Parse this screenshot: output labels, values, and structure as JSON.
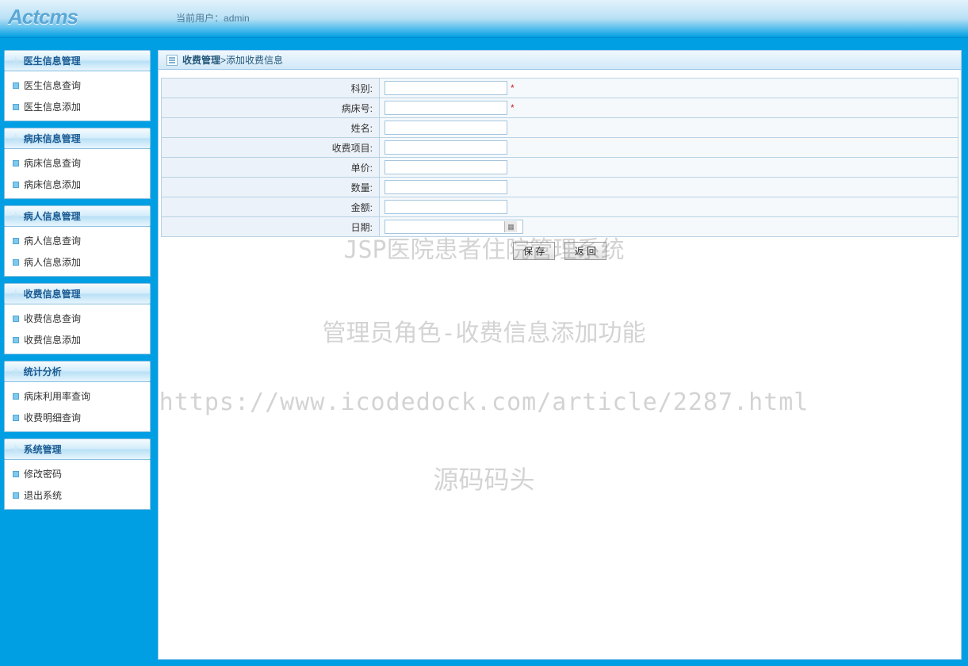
{
  "header": {
    "logo_text": "Actcms",
    "user_label": "当前用户：",
    "username": "admin"
  },
  "sidebar": [
    {
      "title": "医生信息管理",
      "items": [
        "医生信息查询",
        "医生信息添加"
      ]
    },
    {
      "title": "病床信息管理",
      "items": [
        "病床信息查询",
        "病床信息添加"
      ]
    },
    {
      "title": "病人信息管理",
      "items": [
        "病人信息查询",
        "病人信息添加"
      ]
    },
    {
      "title": "收费信息管理",
      "items": [
        "收费信息查询",
        "收费信息添加"
      ]
    },
    {
      "title": "统计分析",
      "items": [
        "病床利用率查询",
        "收费明细查询"
      ]
    },
    {
      "title": "系统管理",
      "items": [
        "修改密码",
        "退出系统"
      ]
    }
  ],
  "breadcrumb": {
    "section": "收费管理",
    "sep": " > ",
    "page": "添加收费信息"
  },
  "form": {
    "fields": [
      {
        "label": "科别:",
        "value": "",
        "required": true
      },
      {
        "label": "病床号:",
        "value": "",
        "required": true
      },
      {
        "label": "姓名:",
        "value": "",
        "required": false
      },
      {
        "label": "收费项目:",
        "value": "",
        "required": false
      },
      {
        "label": "单价:",
        "value": "",
        "required": false
      },
      {
        "label": "数量:",
        "value": "",
        "required": false
      },
      {
        "label": "金额:",
        "value": "",
        "required": false
      },
      {
        "label": "日期:",
        "value": "",
        "required": false,
        "date": true
      }
    ],
    "required_mark": "*",
    "buttons": {
      "save": "保 存",
      "back": "返 回"
    }
  },
  "watermarks": {
    "line1": "JSP医院患者住院管理系统",
    "line2": "管理员角色-收费信息添加功能",
    "line3": "https://www.icodedock.com/article/2287.html",
    "line4": "源码码头"
  }
}
